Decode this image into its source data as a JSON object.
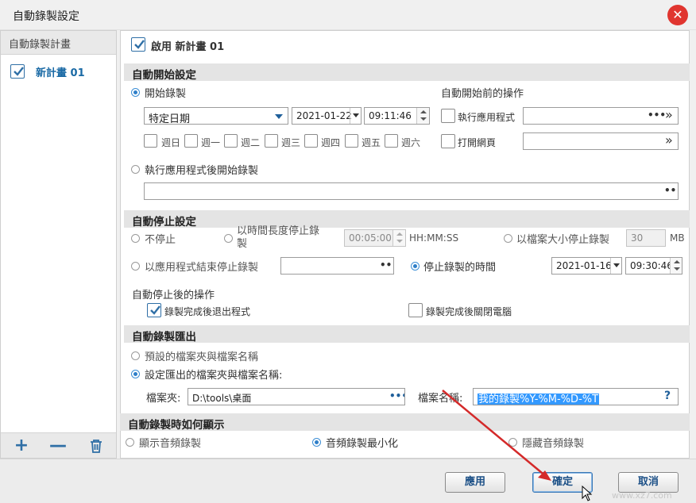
{
  "window": {
    "title": "自動錄製設定"
  },
  "sidebar": {
    "header": "自動錄製計畫",
    "items": [
      {
        "label": "新計畫 01",
        "checked": true
      }
    ],
    "footer": {
      "add": "+",
      "remove": "—"
    }
  },
  "plan": {
    "enable_label": "啟用 新計畫 01",
    "enabled": true
  },
  "auto_start": {
    "title": "自動開始設定",
    "start_recording_label": "開始錄製",
    "mode_value": "特定日期",
    "date_value": "2021-01-22",
    "time_value": "09:11:46",
    "weekdays": [
      "週日",
      "週一",
      "週二",
      "週三",
      "週四",
      "週五",
      "週六"
    ],
    "run_after_app_label": "執行應用程式後開始錄製",
    "before_actions_title": "自動開始前的操作",
    "run_app_label": "執行應用程式",
    "open_web_label": "打開網頁"
  },
  "auto_stop": {
    "title": "自動停止設定",
    "no_stop_label": "不停止",
    "duration_label_line1": "以時間長度停止錄",
    "duration_label_line2": "製",
    "duration_value": "00:05:00",
    "duration_unit": "HH:MM:SS",
    "size_label": "以檔案大小停止錄製",
    "size_value": "30",
    "size_unit": "MB",
    "app_end_label": "以應用程式結束停止錄製",
    "stop_time_label": "停止錄製的時間",
    "stop_date_value": "2021-01-16",
    "stop_time_value": "09:30:46",
    "after_title": "自動停止後的操作",
    "exit_label": "錄製完成後退出程式",
    "exit_checked": true,
    "shutdown_label": "錄製完成後關閉電腦",
    "shutdown_checked": false
  },
  "export": {
    "title": "自動錄製匯出",
    "default_label": "預設的檔案夾與檔案名稱",
    "custom_label": "設定匯出的檔案夾與檔案名稱:",
    "folder_label": "檔案夾:",
    "folder_value": "D:\\tools\\桌面",
    "filename_label": "檔案名稱:",
    "filename_value": "我的錄製%Y-%M-%D-%T",
    "help": "?"
  },
  "display": {
    "title": "自動錄製時如何顯示",
    "options": [
      "顯示音頻錄製",
      "音頻錄製最小化",
      "隱藏音頻錄製"
    ],
    "selected_index": 1
  },
  "buttons": {
    "apply": "應用",
    "ok": "確定",
    "cancel": "取消"
  },
  "watermark": "www.xz7.com",
  "colors": {
    "accent": "#2f6fa6",
    "annotation_arrow": "#d42a2a",
    "close": "#e0352f"
  }
}
